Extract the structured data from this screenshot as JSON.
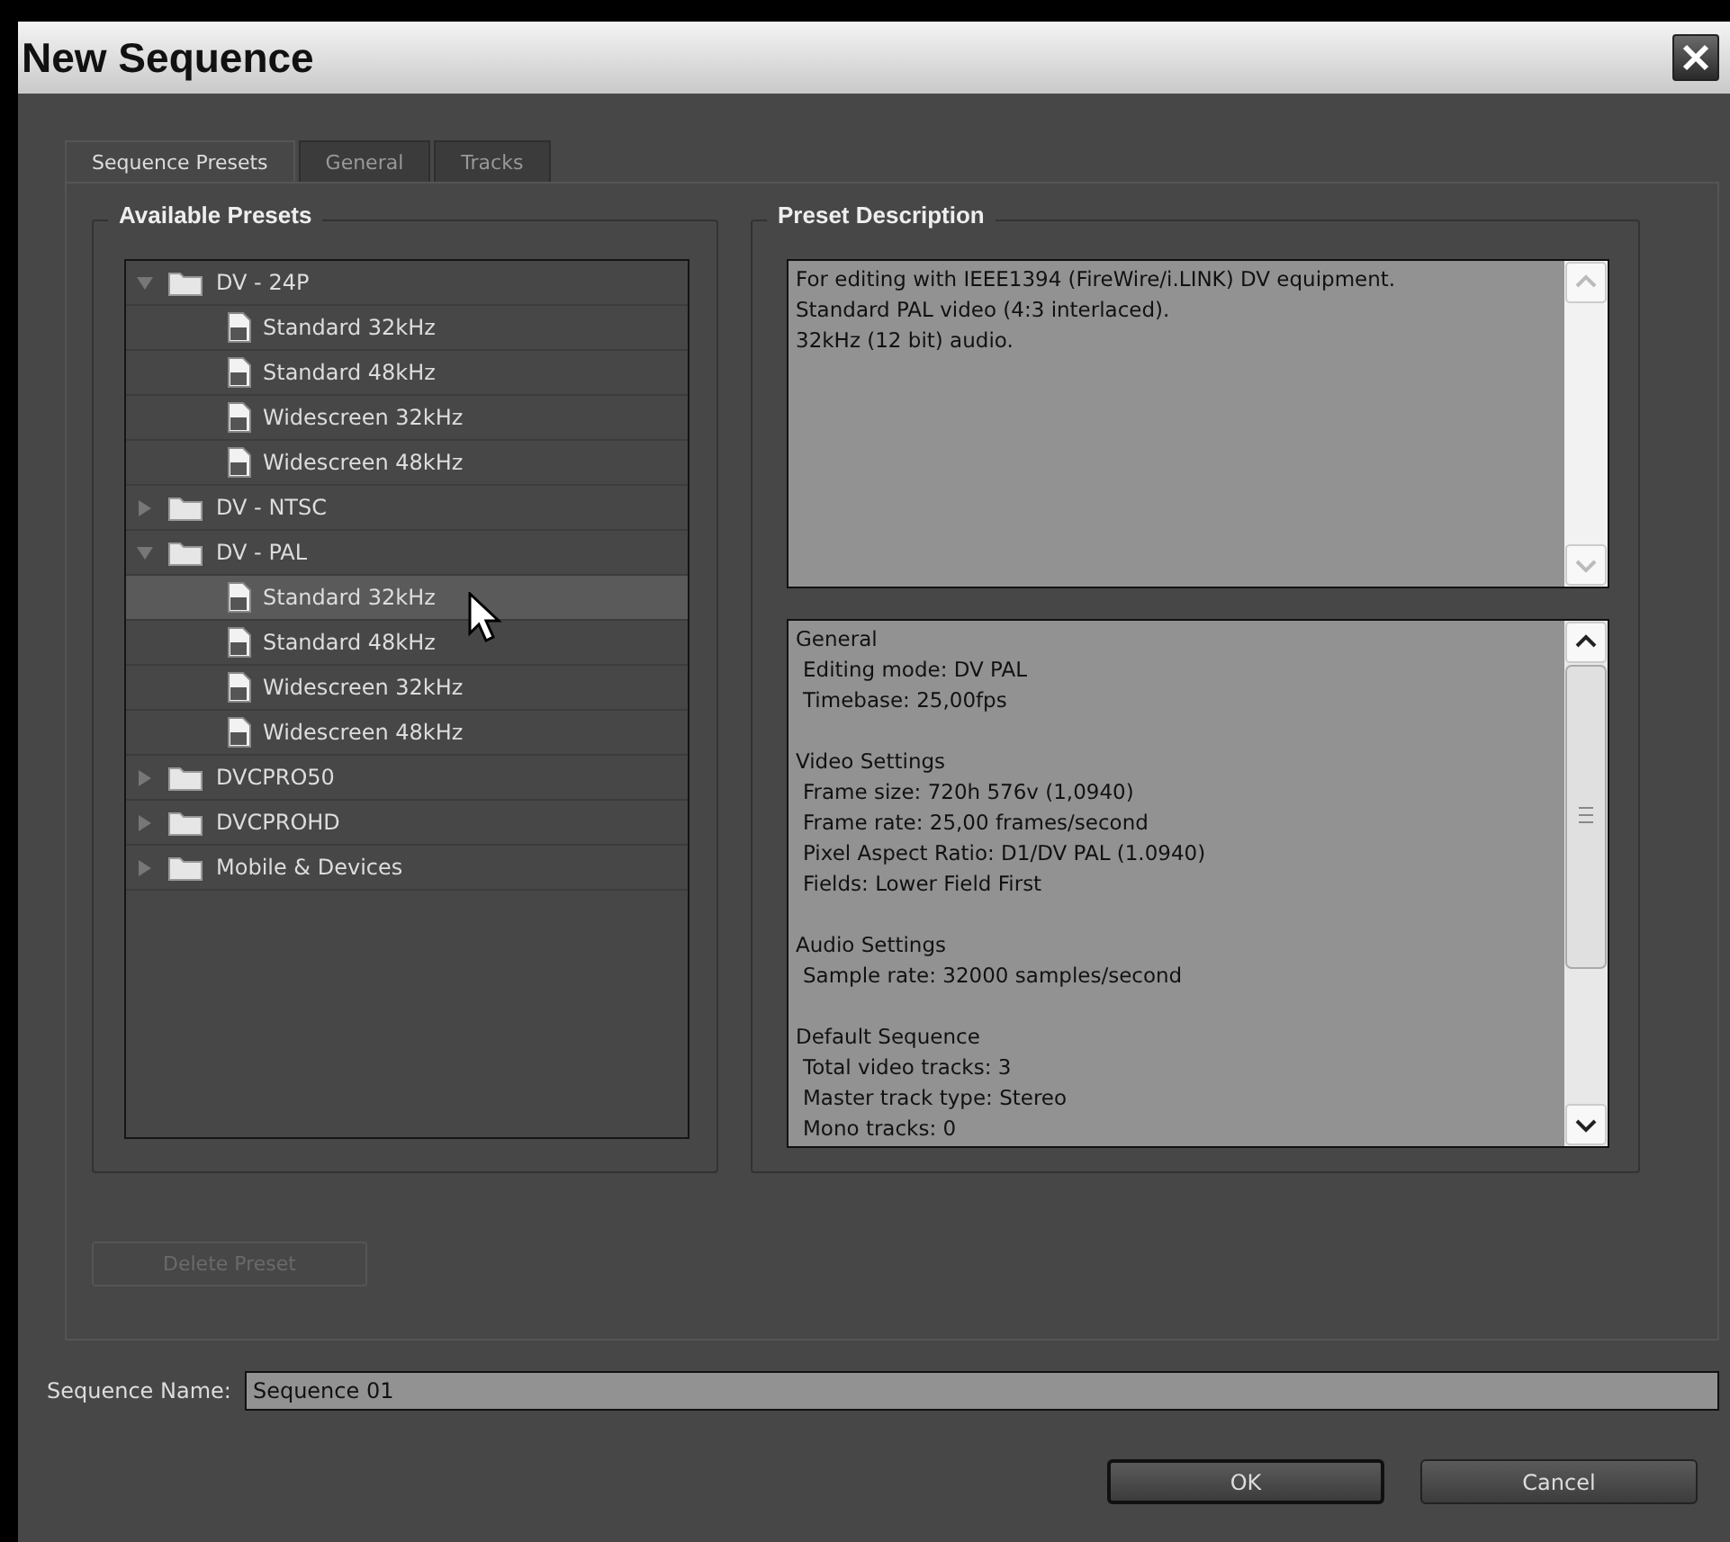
{
  "window": {
    "title": "New Sequence"
  },
  "tabs": [
    {
      "label": "Sequence Presets",
      "selected": true
    },
    {
      "label": "General",
      "selected": false
    },
    {
      "label": "Tracks",
      "selected": false
    }
  ],
  "available_presets": {
    "title": "Available Presets",
    "items": [
      {
        "label": "DV - 24P",
        "kind": "folder",
        "expanded": true,
        "selected": false,
        "children": [
          {
            "label": "Standard 32kHz",
            "kind": "preset",
            "selected": false
          },
          {
            "label": "Standard 48kHz",
            "kind": "preset",
            "selected": false
          },
          {
            "label": "Widescreen 32kHz",
            "kind": "preset",
            "selected": false
          },
          {
            "label": "Widescreen 48kHz",
            "kind": "preset",
            "selected": false
          }
        ]
      },
      {
        "label": "DV - NTSC",
        "kind": "folder",
        "expanded": false,
        "selected": false
      },
      {
        "label": "DV - PAL",
        "kind": "folder",
        "expanded": true,
        "selected": false,
        "children": [
          {
            "label": "Standard 32kHz",
            "kind": "preset",
            "selected": true
          },
          {
            "label": "Standard 48kHz",
            "kind": "preset",
            "selected": false
          },
          {
            "label": "Widescreen 32kHz",
            "kind": "preset",
            "selected": false
          },
          {
            "label": "Widescreen 48kHz",
            "kind": "preset",
            "selected": false
          }
        ]
      },
      {
        "label": "DVCPRO50",
        "kind": "folder",
        "expanded": false,
        "selected": false
      },
      {
        "label": "DVCPROHD",
        "kind": "folder",
        "expanded": false,
        "selected": false
      },
      {
        "label": "Mobile & Devices",
        "kind": "folder",
        "expanded": false,
        "selected": false
      }
    ],
    "delete_button": {
      "label": "Delete Preset",
      "disabled": true
    }
  },
  "preset_description": {
    "title": "Preset Description",
    "description": [
      "For editing with IEEE1394 (FireWire/i.LINK) DV equipment.",
      "Standard PAL video (4:3 interlaced).",
      "32kHz (12 bit) audio."
    ],
    "details": [
      {
        "heading": "General",
        "lines": [
          "Editing mode: DV PAL",
          "Timebase: 25,00fps"
        ]
      },
      {
        "heading": "Video Settings",
        "lines": [
          "Frame size: 720h 576v (1,0940)",
          "Frame rate: 25,00 frames/second",
          "Pixel Aspect Ratio: D1/DV PAL (1.0940)",
          "Fields: Lower Field First"
        ]
      },
      {
        "heading": "Audio Settings",
        "lines": [
          "Sample rate: 32000 samples/second"
        ]
      },
      {
        "heading": "Default Sequence",
        "lines": [
          "Total video tracks: 3",
          "Master track type: Stereo",
          "Mono tracks: 0"
        ]
      }
    ]
  },
  "sequence_name": {
    "label": "Sequence Name:",
    "value": "Sequence 01"
  },
  "buttons": [
    {
      "label": "OK",
      "kind": "default"
    },
    {
      "label": "Cancel",
      "kind": "normal"
    }
  ]
}
